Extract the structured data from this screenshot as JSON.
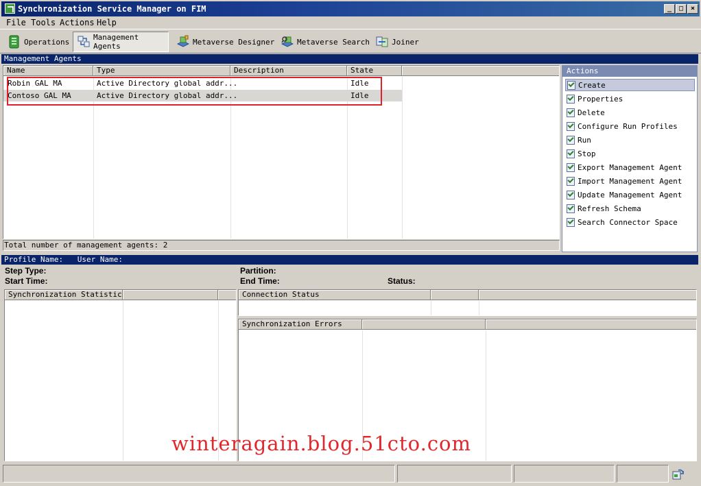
{
  "window": {
    "title": "Synchronization Service Manager on FIM"
  },
  "menu": [
    {
      "label": "File",
      "mnemonic": "F"
    },
    {
      "label": "Tools",
      "mnemonic": "T"
    },
    {
      "label": "Actions",
      "mnemonic": "A"
    },
    {
      "label": "Help",
      "mnemonic": "H"
    }
  ],
  "toolbar": {
    "operations": "Operations",
    "management_agents": "Management Agents",
    "metaverse_designer": "Metaverse Designer",
    "metaverse_search": "Metaverse Search",
    "joiner": "Joiner"
  },
  "ma_section": {
    "header": "Management Agents",
    "columns": [
      "Name",
      "Type",
      "Description",
      "State"
    ],
    "rows": [
      {
        "name": "Robin GAL MA",
        "type": "Active Directory global addr...",
        "description": "",
        "state": "Idle"
      },
      {
        "name": "Contoso GAL MA",
        "type": "Active Directory global addr...",
        "description": "",
        "state": "Idle"
      }
    ],
    "total_label": "Total number of management agents: 2"
  },
  "actions": {
    "header": "Actions",
    "items": [
      "Create",
      "Properties",
      "Delete",
      "Configure Run Profiles",
      "Run",
      "Stop",
      "Export Management Agent",
      "Import Management Agent",
      "Update Management Agent",
      "Refresh Schema",
      "Search Connector Space"
    ],
    "selected": "Create"
  },
  "profile_bar": {
    "profile_name_label": "Profile Name:",
    "user_name_label": "User Name:"
  },
  "details": {
    "step_type_label": "Step Type:",
    "start_time_label": "Start Time:",
    "partition_label": "Partition:",
    "end_time_label": "End Time:",
    "status_label": "Status:"
  },
  "sync_stats": {
    "header": "Synchronization Statistics"
  },
  "connection_status": {
    "header": "Connection Status"
  },
  "sync_errors": {
    "header": "Synchronization Errors"
  },
  "watermark": "winteragain.blog.51cto.com",
  "colors": {
    "titlebar": "#0a246a",
    "section_header": "#0a246a",
    "highlight_box": "#e0202a",
    "watermark": "#e0282c"
  }
}
